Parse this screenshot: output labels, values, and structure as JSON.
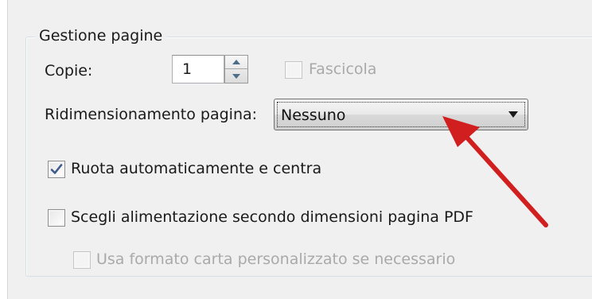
{
  "group": {
    "title": "Gestione pagine"
  },
  "copies": {
    "label": "Copie:",
    "value": "1"
  },
  "collate": {
    "label": "Fascicola",
    "checked": false,
    "enabled": false
  },
  "page_scaling": {
    "label": "Ridimensionamento pagina:",
    "selected": "Nessuno"
  },
  "auto_rotate": {
    "label": "Ruota automaticamente e centra",
    "checked": true
  },
  "paper_source": {
    "label": "Scegli alimentazione secondo dimensioni pagina PDF",
    "checked": false
  },
  "custom_paper": {
    "label": "Usa formato carta personalizzato se necessario",
    "checked": false,
    "enabled": false
  },
  "colors": {
    "annotation_arrow": "#d11f1f",
    "checkmark": "#3d5a8a"
  }
}
